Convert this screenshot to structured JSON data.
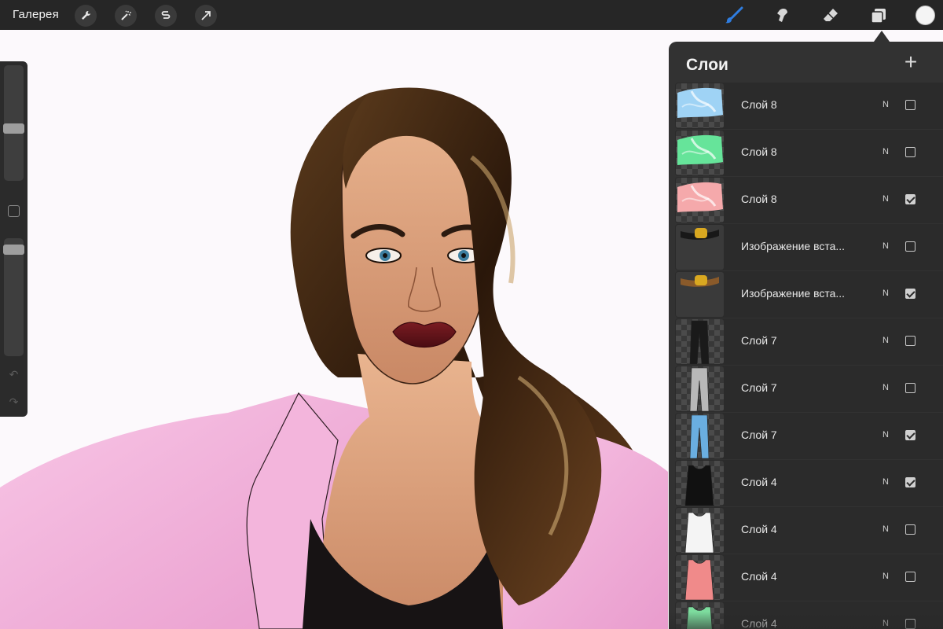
{
  "topbar": {
    "gallery_label": "Галерея",
    "left_tools": [
      "wrench-icon",
      "magic-wand-icon",
      "selection-s-icon",
      "transform-arrow-icon"
    ],
    "right_tools": [
      "brush-icon",
      "smudge-icon",
      "eraser-icon",
      "layers-icon"
    ],
    "brush_color": "#2f7de0",
    "current_color": "#f4f4f4"
  },
  "sidebar": {
    "brush_size_level": 0.45,
    "opacity_level": 0.06,
    "icons": [
      "modify-square-icon",
      "undo-icon",
      "redo-icon"
    ]
  },
  "layers_panel": {
    "title": "Слои",
    "add_icon": "plus-icon",
    "layers": [
      {
        "name": "Слой 8",
        "mode": "N",
        "visible": false,
        "thumb": "shape-blue",
        "color": "#9fd3f5"
      },
      {
        "name": "Слой 8",
        "mode": "N",
        "visible": false,
        "thumb": "shape-green",
        "color": "#66e49a"
      },
      {
        "name": "Слой 8",
        "mode": "N",
        "visible": true,
        "thumb": "shape-pink",
        "color": "#f5a9ab"
      },
      {
        "name": "Изображение вста...",
        "mode": "N",
        "visible": false,
        "thumb": "belt-black",
        "color": "#d9a820"
      },
      {
        "name": "Изображение вста...",
        "mode": "N",
        "visible": true,
        "thumb": "belt-brown",
        "color": "#d9a820"
      },
      {
        "name": "Слой 7",
        "mode": "N",
        "visible": false,
        "thumb": "pants",
        "color": "#1a1a1a"
      },
      {
        "name": "Слой 7",
        "mode": "N",
        "visible": false,
        "thumb": "pants",
        "color": "#b8b8b8"
      },
      {
        "name": "Слой 7",
        "mode": "N",
        "visible": true,
        "thumb": "pants",
        "color": "#6aaee0"
      },
      {
        "name": "Слой 4",
        "mode": "N",
        "visible": true,
        "thumb": "top",
        "color": "#111111"
      },
      {
        "name": "Слой 4",
        "mode": "N",
        "visible": false,
        "thumb": "top",
        "color": "#f4f4f4"
      },
      {
        "name": "Слой 4",
        "mode": "N",
        "visible": false,
        "thumb": "top",
        "color": "#f08a8a"
      },
      {
        "name": "Слой 4",
        "mode": "N",
        "visible": false,
        "thumb": "top",
        "color": "#7ddc9e"
      }
    ]
  }
}
